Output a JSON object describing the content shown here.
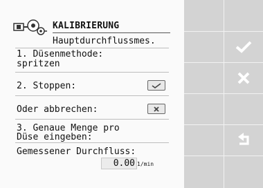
{
  "header": {
    "title": "KALIBRIERUNG",
    "subtitle": "Hauptdurchflussmes."
  },
  "steps": {
    "step1_label": "1. Düsenmethode:",
    "step1_value": "spritzen",
    "step2_label": "2. Stoppen:",
    "cancel_label": "Oder abbrechen:",
    "step3_line1": "3. Genaue Menge pro",
    "step3_line2": "Düse eingeben:",
    "measured_label": "Gemessener Durchfluss:",
    "measured_value": "0.00",
    "measured_unit": "1/min"
  },
  "softkeys": [
    "confirm-icon",
    "cancel-icon",
    "return-icon"
  ],
  "colors": {
    "content_bg": "#fafafa",
    "sidebar_bg": "#d3d3d3"
  }
}
